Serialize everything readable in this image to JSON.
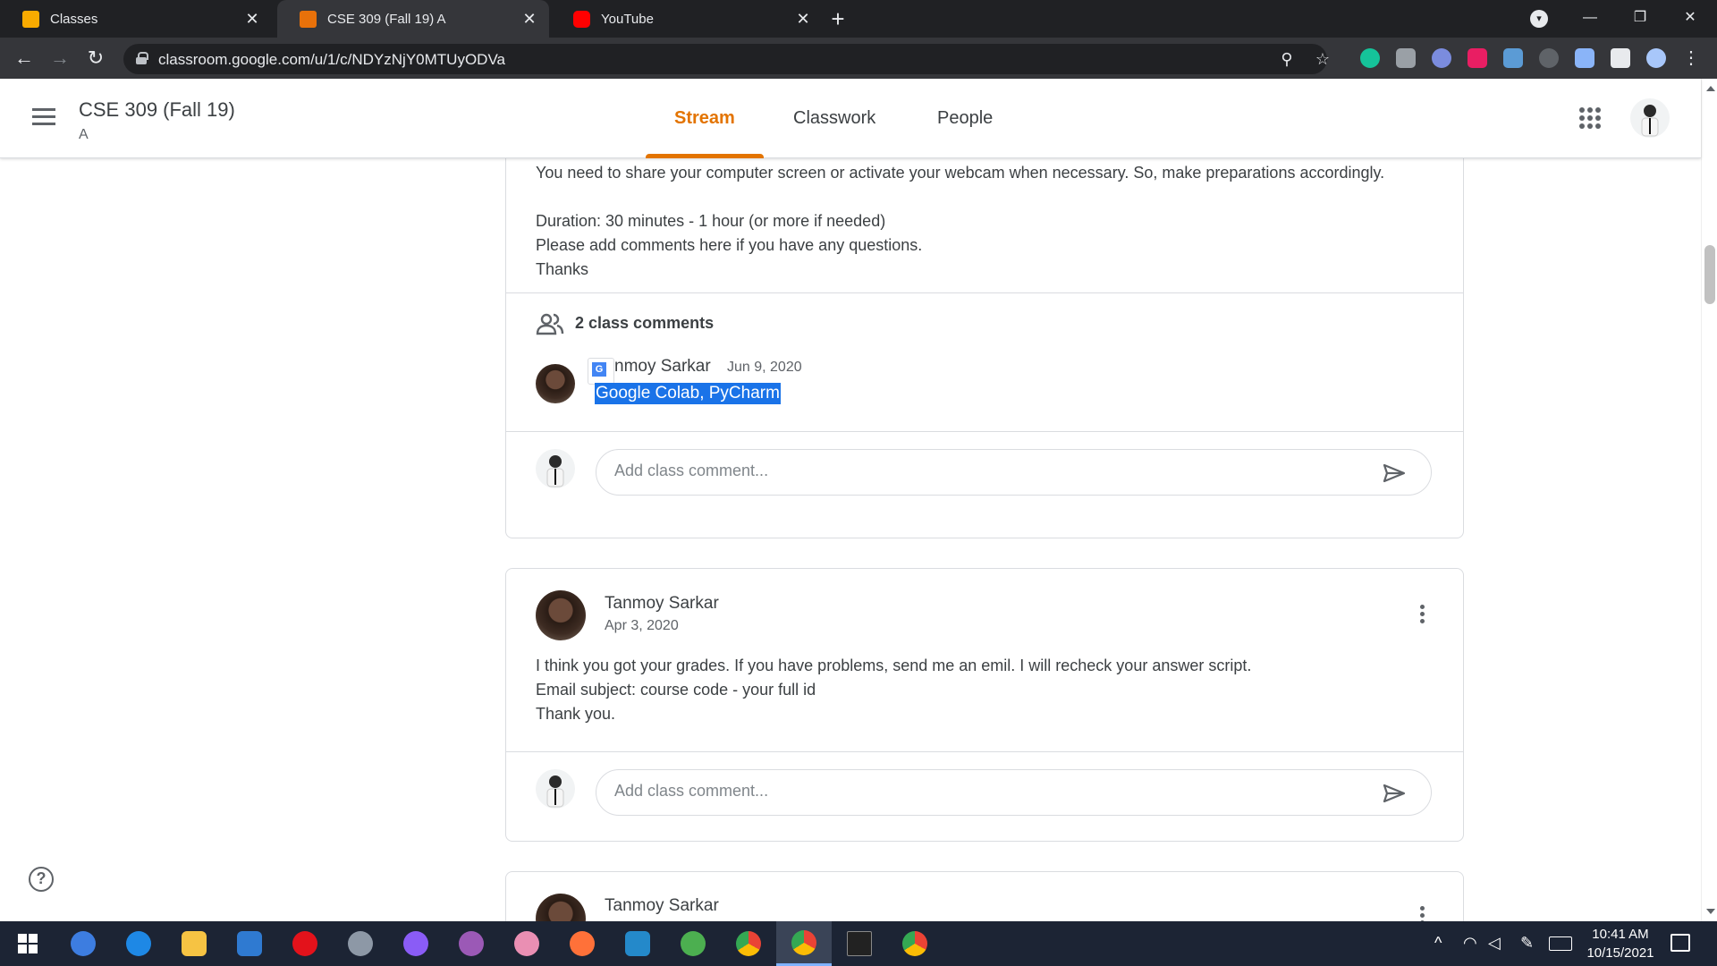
{
  "browser": {
    "tabs": [
      {
        "label": "Classes",
        "color": "#f9ab00"
      },
      {
        "label": "CSE 309 (Fall 19) A",
        "color": "#e8710a"
      },
      {
        "label": "YouTube",
        "color": "#ff0000"
      }
    ],
    "close_glyph": "✕",
    "new_tab_glyph": "+",
    "url": "classroom.google.com/u/1/c/NDYzNjY0MTUyODVa",
    "window": {
      "minimize": "—",
      "restore": "❐",
      "close": "✕"
    }
  },
  "header": {
    "course_title": "CSE 309 (Fall 19)",
    "course_section": "A",
    "tabs": [
      "Stream",
      "Classwork",
      "People"
    ],
    "active_tab": 0,
    "accent": "#e37400"
  },
  "post1": {
    "lines": [
      "You need to share your computer screen or activate your webcam when necessary. So, make preparations accordingly.",
      "",
      "Duration: 30 minutes - 1 hour (or more if needed)",
      "Please add comments here if you have any questions.",
      "Thanks"
    ],
    "comments_count_label": "2 class comments",
    "comment": {
      "author_visible": "nmoy Sarkar",
      "date": "Jun 9, 2020",
      "text": "Google Colab, PyCharm"
    },
    "comment_placeholder": "Add class comment..."
  },
  "post2": {
    "author": "Tanmoy Sarkar",
    "date": "Apr 3, 2020",
    "lines": [
      "I think you got your grades. If you have problems, send me an emil. I will recheck your answer script.",
      "Email subject: course code - your full id",
      "Thank you."
    ],
    "comment_placeholder": "Add class comment..."
  },
  "post3": {
    "author": "Tanmoy Sarkar"
  },
  "help": {
    "glyph": "?"
  },
  "taskbar": {
    "time": "10:41 AM",
    "date": "10/15/2021"
  }
}
